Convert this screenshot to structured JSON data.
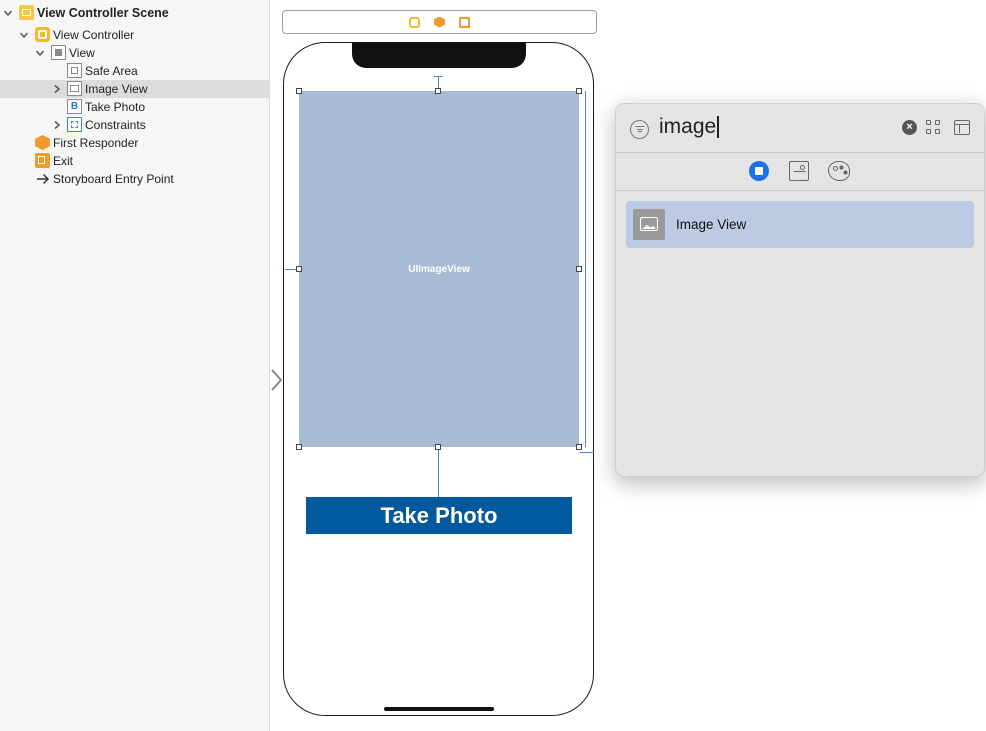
{
  "outline": {
    "items": [
      {
        "label": "View Controller Scene"
      },
      {
        "label": "View Controller"
      },
      {
        "label": "View"
      },
      {
        "label": "Safe Area"
      },
      {
        "label": "Image View"
      },
      {
        "label": "Take Photo"
      },
      {
        "label": "Constraints"
      },
      {
        "label": "First Responder"
      },
      {
        "label": "Exit"
      },
      {
        "label": "Storyboard Entry Point"
      }
    ]
  },
  "canvas": {
    "imageview_placeholder": "UIImageView",
    "button_label": "Take Photo"
  },
  "library": {
    "search_value": "image",
    "results": [
      {
        "label": "Image View"
      }
    ]
  },
  "colors": {
    "imageview_bg": "#a7bbd5",
    "button_bg": "#03599e",
    "selection": "#bccbe3",
    "accent": "#1a73e8"
  }
}
